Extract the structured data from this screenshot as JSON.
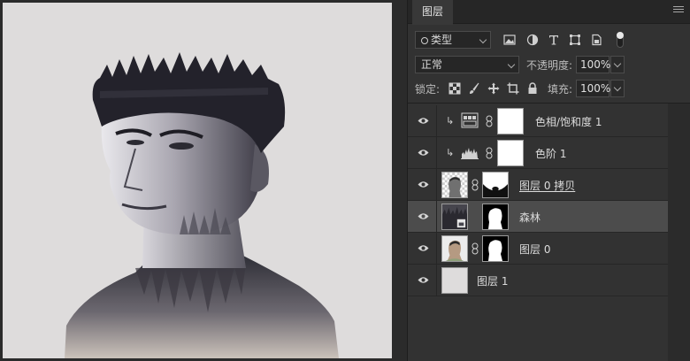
{
  "panel": {
    "tab_title": "图层",
    "menu_icon": "hamburger-icon"
  },
  "filter": {
    "kind_label": "类型",
    "icons": [
      "image-filter-icon",
      "adjustment-filter-icon",
      "text-filter-icon",
      "shape-filter-icon",
      "smart-object-filter-icon",
      "filter-toggle-icon"
    ]
  },
  "blend": {
    "mode": "正常",
    "opacity_label": "不透明度:",
    "opacity_value": "100%"
  },
  "lock": {
    "label": "锁定:",
    "icons": [
      "lock-transparent-icon",
      "lock-paint-icon",
      "lock-position-icon",
      "lock-artboard-icon",
      "lock-all-icon"
    ],
    "fill_label": "填充:",
    "fill_value": "100%"
  },
  "layers": [
    {
      "name": "色相/饱和度 1",
      "visible": true,
      "clipped": true,
      "kind": "hue-saturation-adjustment",
      "selected": false
    },
    {
      "name": "色阶 1",
      "visible": true,
      "clipped": true,
      "kind": "levels-adjustment",
      "selected": false
    },
    {
      "name": "图层 0 拷贝",
      "visible": true,
      "clipped": false,
      "kind": "pixel-with-mask",
      "selected": false,
      "underlined": true
    },
    {
      "name": "森林",
      "visible": true,
      "clipped": false,
      "kind": "smart-object-with-mask",
      "selected": true
    },
    {
      "name": "图层 0",
      "visible": true,
      "clipped": false,
      "kind": "pixel-with-mask",
      "selected": false
    },
    {
      "name": "图层 1",
      "visible": true,
      "clipped": false,
      "kind": "pixel",
      "selected": false
    }
  ],
  "colors": {
    "panel_bg": "#323232",
    "selected_row": "#4c4c4c",
    "canvas_bg": "#dedcdc"
  }
}
